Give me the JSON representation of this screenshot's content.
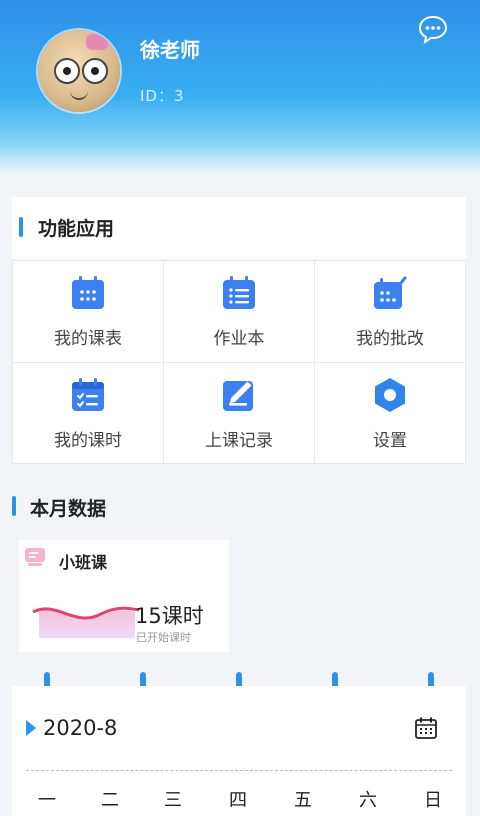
{
  "profile": {
    "name": "徐老师",
    "id_text": "ID：3"
  },
  "features": {
    "title": "功能应用",
    "items": [
      {
        "label": "我的课表",
        "icon": "calendar-grid-icon"
      },
      {
        "label": "作业本",
        "icon": "list-calendar-icon"
      },
      {
        "label": "我的批改",
        "icon": "calendar-edit-icon"
      },
      {
        "label": "我的课时",
        "icon": "calendar-checklist-icon"
      },
      {
        "label": "上课记录",
        "icon": "notebook-pen-icon"
      },
      {
        "label": "设置",
        "icon": "hexagon-gear-icon"
      }
    ]
  },
  "monthly": {
    "title": "本月数据",
    "card": {
      "title": "小班课",
      "value": "15课时",
      "subtitle": "已开始课时"
    }
  },
  "calendar": {
    "month": "2020-8",
    "weekdays": [
      "一",
      "二",
      "三",
      "四",
      "五",
      "六",
      "日"
    ]
  },
  "colors": {
    "accent": "#2a93ea",
    "header_top": "#2f8fe8",
    "icon_blue": "#3b7ff0"
  }
}
